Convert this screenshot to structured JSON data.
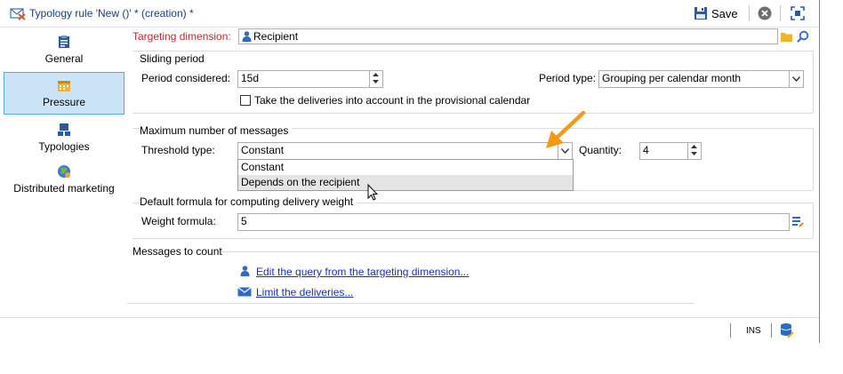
{
  "window": {
    "title": "Typology rule 'New ()' * (creation) *",
    "save_label": "Save"
  },
  "sidebar": {
    "items": [
      {
        "label": "General",
        "icon": "clipboard-icon"
      },
      {
        "label": "Pressure",
        "icon": "calendar-icon",
        "active": true
      },
      {
        "label": "Typologies",
        "icon": "typologies-icon"
      },
      {
        "label": "Distributed marketing",
        "icon": "globe-icon"
      }
    ]
  },
  "targeting": {
    "label": "Targeting dimension:",
    "value": "Recipient"
  },
  "sliding_period": {
    "title": "Sliding period",
    "period_label": "Period considered:",
    "period_value": "15d",
    "period_type_label": "Period type:",
    "period_type_value": "Grouping per calendar month",
    "provisional_label": "Take the deliveries into account in the provisional calendar"
  },
  "max_messages": {
    "title": "Maximum number of messages",
    "threshold_label": "Threshold type:",
    "threshold_value": "Constant",
    "options": [
      "Constant",
      "Depends on the recipient"
    ],
    "quantity_label": "Quantity:",
    "quantity_value": "4"
  },
  "weight": {
    "title": "Default formula for computing delivery weight",
    "formula_label": "Weight formula:",
    "formula_value": "5"
  },
  "messages_to_count": {
    "title": "Messages to count",
    "edit_query_link": "Edit the query from the targeting dimension...",
    "limit_link": "Limit the deliveries..."
  },
  "statusbar": {
    "ins": "INS"
  },
  "colors": {
    "accent": "#3c9be0",
    "required_label": "#c0282b",
    "link": "#1a2fb0",
    "arrow": "#f39a1b",
    "active_tab_bg": "#cce4f7"
  }
}
